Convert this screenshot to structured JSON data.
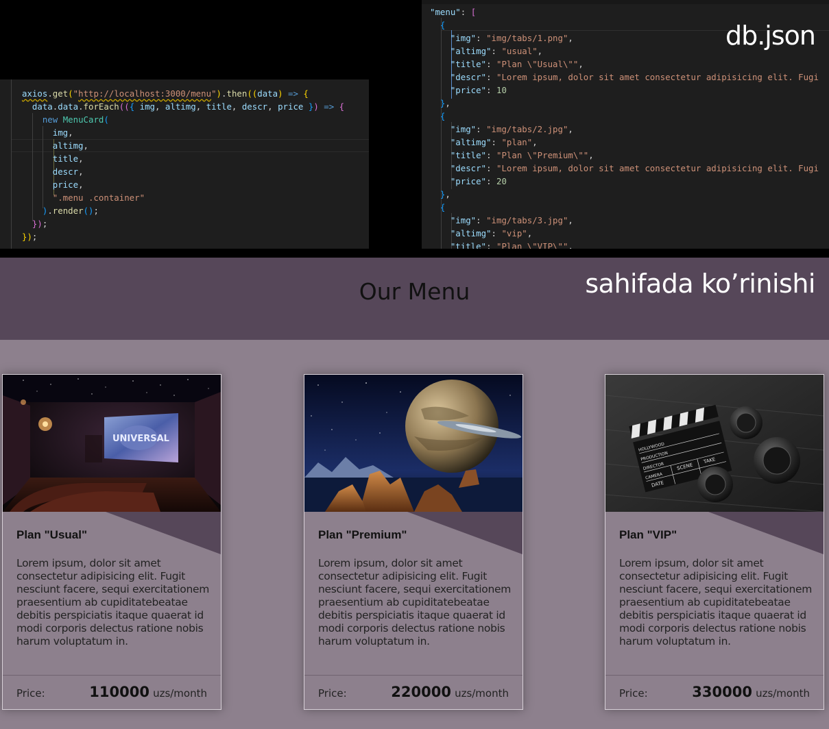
{
  "left_editor": {
    "lines": [
      [
        [
          "axios",
          "t-prop squig"
        ],
        [
          ".",
          "t-pun"
        ],
        [
          "get",
          "t-fn"
        ],
        [
          "(",
          "t-br1"
        ],
        [
          "\"",
          "t-str"
        ],
        [
          "http://localhost:3000/menu",
          "t-str squig"
        ],
        [
          "\"",
          "t-str"
        ],
        [
          ")",
          "t-br1"
        ],
        [
          ".",
          "t-pun"
        ],
        [
          "then",
          "t-fn"
        ],
        [
          "((",
          "t-br1"
        ],
        [
          "data",
          "t-prop"
        ],
        [
          ")",
          "t-br1"
        ],
        [
          " => ",
          "t-kw"
        ],
        [
          "{",
          "t-br1"
        ]
      ],
      [
        [
          "  data",
          "t-prop"
        ],
        [
          ".",
          "t-pun"
        ],
        [
          "data",
          "t-prop"
        ],
        [
          ".",
          "t-pun"
        ],
        [
          "forEach",
          "t-fn"
        ],
        [
          "((",
          "t-br2"
        ],
        [
          "{ ",
          "t-br3"
        ],
        [
          "img",
          "t-prop"
        ],
        [
          ", ",
          "t-pun"
        ],
        [
          "altimg",
          "t-prop"
        ],
        [
          ", ",
          "t-pun"
        ],
        [
          "title",
          "t-prop"
        ],
        [
          ", ",
          "t-pun"
        ],
        [
          "descr",
          "t-prop"
        ],
        [
          ", ",
          "t-pun"
        ],
        [
          "price",
          "t-prop"
        ],
        [
          " }",
          "t-br3"
        ],
        [
          ")",
          "t-br2"
        ],
        [
          " => ",
          "t-kw"
        ],
        [
          "{",
          "t-br2"
        ]
      ],
      [
        [
          "    ",
          "t-pun"
        ],
        [
          "new",
          "t-kw"
        ],
        [
          " ",
          "t-pun"
        ],
        [
          "MenuCard",
          "t-cls"
        ],
        [
          "(",
          "t-br3"
        ]
      ],
      [
        [
          "      img",
          "t-prop"
        ],
        [
          ",",
          "t-pun"
        ]
      ],
      [
        [
          "      altimg",
          "t-prop"
        ],
        [
          ",",
          "t-pun"
        ]
      ],
      [
        [
          "      title",
          "t-prop"
        ],
        [
          ",",
          "t-pun"
        ]
      ],
      [
        [
          "      descr",
          "t-prop"
        ],
        [
          ",",
          "t-pun"
        ]
      ],
      [
        [
          "      price",
          "t-prop"
        ],
        [
          ",",
          "t-pun"
        ]
      ],
      [
        [
          "      \".menu .container\"",
          "t-str"
        ]
      ],
      [
        [
          "    ",
          "t-pun"
        ],
        [
          ")",
          "t-br3"
        ],
        [
          ".",
          "t-pun"
        ],
        [
          "render",
          "t-fn"
        ],
        [
          "()",
          "t-br3"
        ],
        [
          ";",
          "t-pun"
        ]
      ],
      [
        [
          "  ",
          "t-pun"
        ],
        [
          "})",
          "t-br2"
        ],
        [
          ";",
          "t-pun"
        ]
      ],
      [
        [
          "})",
          "t-br1"
        ],
        [
          ";",
          "t-pun"
        ]
      ]
    ]
  },
  "right_editor": {
    "file_label": "db.json",
    "lines": [
      [
        [
          "\"menu\"",
          "t-prop"
        ],
        [
          ": ",
          "t-pun"
        ],
        [
          "[",
          "t-br2"
        ]
      ],
      [
        [
          "  ",
          "t-pun"
        ],
        [
          "{",
          "t-br3"
        ]
      ],
      [
        [
          "    \"img\"",
          "t-prop"
        ],
        [
          ": ",
          "t-pun"
        ],
        [
          "\"img/tabs/1.png\"",
          "t-str"
        ],
        [
          ",",
          "t-pun"
        ]
      ],
      [
        [
          "    \"altimg\"",
          "t-prop"
        ],
        [
          ": ",
          "t-pun"
        ],
        [
          "\"usual\"",
          "t-str"
        ],
        [
          ",",
          "t-pun"
        ]
      ],
      [
        [
          "    \"title\"",
          "t-prop"
        ],
        [
          ": ",
          "t-pun"
        ],
        [
          "\"Plan \\\"Usual\\\"\"",
          "t-str"
        ],
        [
          ",",
          "t-pun"
        ]
      ],
      [
        [
          "    \"descr\"",
          "t-prop"
        ],
        [
          ": ",
          "t-pun"
        ],
        [
          "\"Lorem ipsum, dolor sit amet consectetur adipisicing elit. Fugi",
          "t-str"
        ]
      ],
      [
        [
          "    \"price\"",
          "t-prop"
        ],
        [
          ": ",
          "t-pun"
        ],
        [
          "10",
          "t-num"
        ]
      ],
      [
        [
          "  ",
          "t-pun"
        ],
        [
          "}",
          "t-br3"
        ],
        [
          ",",
          "t-pun"
        ]
      ],
      [
        [
          "  ",
          "t-pun"
        ],
        [
          "{",
          "t-br3"
        ]
      ],
      [
        [
          "    \"img\"",
          "t-prop"
        ],
        [
          ": ",
          "t-pun"
        ],
        [
          "\"img/tabs/2.jpg\"",
          "t-str"
        ],
        [
          ",",
          "t-pun"
        ]
      ],
      [
        [
          "    \"altimg\"",
          "t-prop"
        ],
        [
          ": ",
          "t-pun"
        ],
        [
          "\"plan\"",
          "t-str"
        ],
        [
          ",",
          "t-pun"
        ]
      ],
      [
        [
          "    \"title\"",
          "t-prop"
        ],
        [
          ": ",
          "t-pun"
        ],
        [
          "\"Plan \\\"Premium\\\"\"",
          "t-str"
        ],
        [
          ",",
          "t-pun"
        ]
      ],
      [
        [
          "    \"descr\"",
          "t-prop"
        ],
        [
          ": ",
          "t-pun"
        ],
        [
          "\"Lorem ipsum, dolor sit amet consectetur adipisicing elit. Fugi",
          "t-str"
        ]
      ],
      [
        [
          "    \"price\"",
          "t-prop"
        ],
        [
          ": ",
          "t-pun"
        ],
        [
          "20",
          "t-num"
        ]
      ],
      [
        [
          "  ",
          "t-pun"
        ],
        [
          "}",
          "t-br3"
        ],
        [
          ",",
          "t-pun"
        ]
      ],
      [
        [
          "  ",
          "t-pun"
        ],
        [
          "{",
          "t-br3"
        ]
      ],
      [
        [
          "    \"img\"",
          "t-prop"
        ],
        [
          ": ",
          "t-pun"
        ],
        [
          "\"img/tabs/3.jpg\"",
          "t-str"
        ],
        [
          ",",
          "t-pun"
        ]
      ],
      [
        [
          "    \"altimg\"",
          "t-prop"
        ],
        [
          ": ",
          "t-pun"
        ],
        [
          "\"vip\"",
          "t-str"
        ],
        [
          ",",
          "t-pun"
        ]
      ],
      [
        [
          "    \"title\"",
          "t-prop"
        ],
        [
          ": ",
          "t-pun"
        ],
        [
          "\"Plan \\\"VIP\\\"\"",
          "t-str"
        ],
        [
          ",",
          "t-pun"
        ]
      ]
    ]
  },
  "page": {
    "menu_title": "Our Menu",
    "view_label": "sahifada ko’rinishi",
    "cards": [
      {
        "image_name": "home-cinema-image",
        "title": "Plan \"Usual\"",
        "descr": "Lorem ipsum, dolor sit amet consectetur adipisicing elit. Fugit nesciunt facere, sequi exercitationem praesentium ab cupiditatebeatae debitis perspiciatis itaque quaerat id modi corporis delectus ratione nobis harum voluptatum in.",
        "price_label": "Price:",
        "price": "110000",
        "unit": "uzs/month"
      },
      {
        "image_name": "space-planet-image",
        "title": "Plan \"Premium\"",
        "descr": "Lorem ipsum, dolor sit amet consectetur adipisicing elit. Fugit nesciunt facere, sequi exercitationem praesentium ab cupiditatebeatae debitis perspiciatis itaque quaerat id modi corporis delectus ratione nobis harum voluptatum in.",
        "price_label": "Price:",
        "price": "220000",
        "unit": "uzs/month"
      },
      {
        "image_name": "clapperboard-image",
        "title": "Plan \"VIP\"",
        "descr": "Lorem ipsum, dolor sit amet consectetur adipisicing elit. Fugit nesciunt facere, sequi exercitationem praesentium ab cupiditatebeatae debitis perspiciatis itaque quaerat id modi corporis delectus ratione nobis harum voluptatum in.",
        "price_label": "Price:",
        "price": "330000",
        "unit": "uzs/month"
      }
    ],
    "clapper_text": [
      "HOLLYWOOD",
      "PRODUCTION",
      "DIRECTOR",
      "CAMERA",
      "DATE",
      "SCENE",
      "TAKE"
    ],
    "screen_text": "UNIVERSAL"
  },
  "colors": {
    "band": "#564759",
    "cards_bg": "#8d808d",
    "wedge": "#564759"
  }
}
